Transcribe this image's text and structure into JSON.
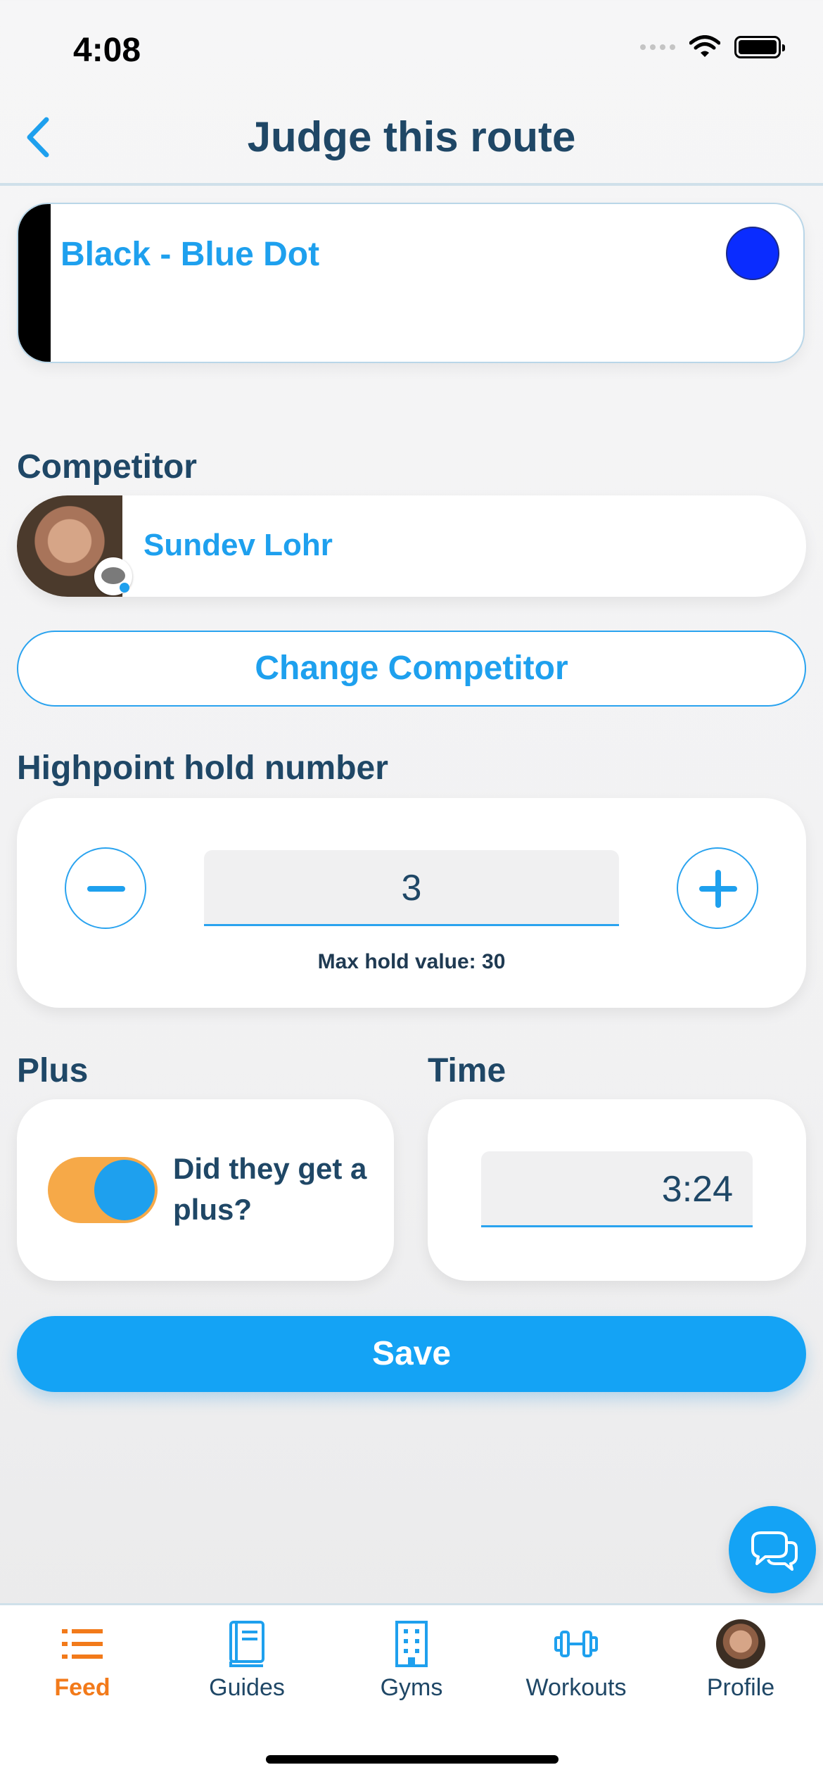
{
  "status_bar": {
    "time": "4:08"
  },
  "header": {
    "title": "Judge this route"
  },
  "route": {
    "name": "Black - Blue Dot",
    "stripe_color": "#000000",
    "dot_color": "#0a2cff"
  },
  "competitor": {
    "label": "Competitor",
    "name": "Sundev Lohr",
    "change_label": "Change Competitor"
  },
  "highpoint": {
    "label": "Highpoint hold number",
    "value": "3",
    "max_text": "Max hold value: 30"
  },
  "plus": {
    "label": "Plus",
    "toggle_text": "Did they get a plus?",
    "toggle_on": true
  },
  "time": {
    "label": "Time",
    "value": "3:24"
  },
  "save_label": "Save",
  "tabbar": {
    "items": [
      {
        "label": "Feed",
        "icon": "list-icon",
        "active": true
      },
      {
        "label": "Guides",
        "icon": "book-icon",
        "active": false
      },
      {
        "label": "Gyms",
        "icon": "building-icon",
        "active": false
      },
      {
        "label": "Workouts",
        "icon": "dumbbell-icon",
        "active": false
      },
      {
        "label": "Profile",
        "icon": "avatar",
        "active": false
      }
    ]
  },
  "colors": {
    "accent": "#14a3f5",
    "active_tab": "#f27a1a",
    "toggle_track": "#f6a948"
  }
}
